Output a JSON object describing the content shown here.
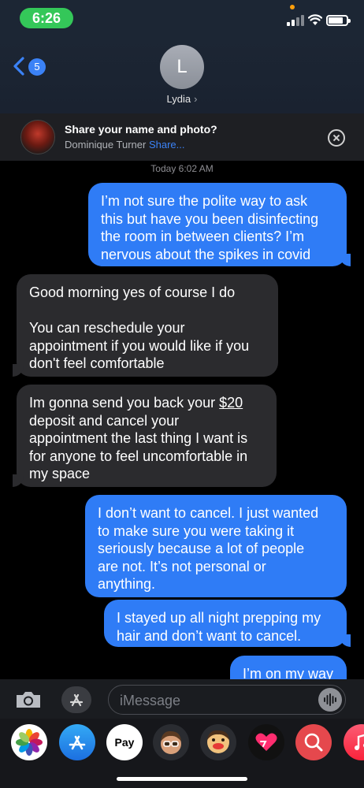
{
  "status_bar": {
    "time": "6:26"
  },
  "header": {
    "back_badge": "5",
    "avatar_initial": "L",
    "contact_name": "Lydia",
    "name_chevron": "›"
  },
  "share_banner": {
    "title": "Share your name and photo?",
    "name": "Dominique Turner",
    "link": "Share..."
  },
  "thread": {
    "timestamp_day": "Today",
    "timestamp_time": "6:02 AM",
    "messages": [
      {
        "direction": "out",
        "text": "I’m not sure the polite way to ask\nthis but have you been disinfecting\nthe room in between clients? I’m\nnervous about the spikes in covid"
      },
      {
        "direction": "in",
        "text": "Good morning yes of course I do\n\nYou can reschedule your\nappointment if you would like if you\ndon't feel comfortable"
      },
      {
        "direction": "in",
        "text_before": "Im gonna send you back your ",
        "amount": "$20",
        "text_after": "\ndeposit and cancel your\nappointment the last thing I want is\nfor anyone to feel uncomfortable in\nmy space"
      },
      {
        "direction": "out",
        "text": "I don’t want to cancel. I just wanted\nto make sure you were taking it\nseriously because a lot of people\nare not. It’s not personal or\nanything."
      },
      {
        "direction": "out",
        "text": "I stayed up all night prepping my\nhair and don’t want to cancel."
      },
      {
        "direction": "out",
        "text": "I’m on my way"
      }
    ]
  },
  "input_bar": {
    "placeholder": "iMessage"
  },
  "app_tray": {
    "apps": [
      "photos-app",
      "app-store",
      "apple-pay",
      "memoji",
      "memoji-stickers",
      "digital-touch",
      "search-images",
      "music"
    ],
    "apple_pay_label": " Pay"
  },
  "colors": {
    "outgoing_bubble": "#2f7cf6",
    "incoming_bubble": "#2b2b2e",
    "time_pill": "#34c759",
    "link": "#3b82f6"
  }
}
